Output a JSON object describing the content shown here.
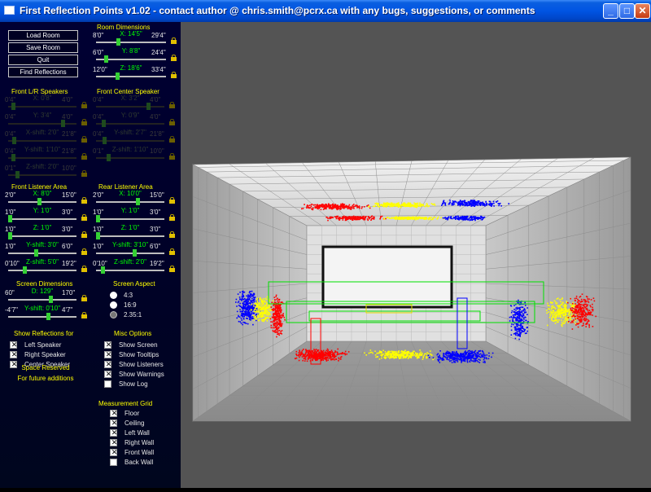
{
  "window": {
    "title": "First Reflection Points v1.02 - contact author @ chris.smith@pcrx.ca with any bugs, suggestions, or comments",
    "minimize": "_",
    "maximize": "□",
    "close": "✕"
  },
  "buttons": {
    "load": "Load Room",
    "save": "Save Room",
    "quit": "Quit",
    "find": "Find Reflections"
  },
  "room": {
    "header": "Room Dimensions",
    "sliders": [
      {
        "min": "8'0\"",
        "max": "29'4\"",
        "label": "X: 14'5\"",
        "value": 0.31,
        "enabled": true,
        "lock": true
      },
      {
        "min": "6'0\"",
        "max": "24'4\"",
        "label": "Y: 8'8\"",
        "value": 0.12,
        "enabled": true,
        "lock": true
      },
      {
        "min": "12'0\"",
        "max": "33'4\"",
        "label": "Z: 18'6\"",
        "value": 0.3,
        "enabled": true,
        "lock": true
      }
    ]
  },
  "front_lr": {
    "header": "Front L/R Speakers",
    "sliders": [
      {
        "min": "0'4\"",
        "max": "4'0\"",
        "label": "X: 0'8\"",
        "value": 0.05,
        "enabled": false,
        "lock": true
      },
      {
        "min": "0'4\"",
        "max": "4'0\"",
        "label": "Y: 3'4\"",
        "value": 0.82,
        "enabled": false,
        "lock": true
      },
      {
        "min": "0'4\"",
        "max": "21'8\"",
        "label": "X-shift: 2'0\"",
        "value": 0.06,
        "enabled": false,
        "lock": true
      },
      {
        "min": "0'4\"",
        "max": "21'8\"",
        "label": "Y-shift: 1'10\"",
        "value": 0.05,
        "enabled": false,
        "lock": true
      },
      {
        "min": "0'1\"",
        "max": "10'0\"",
        "label": "Z-shift: 2'0\"",
        "value": 0.12,
        "enabled": false,
        "lock": true
      }
    ]
  },
  "front_center": {
    "header": "Front Center Speaker",
    "sliders": [
      {
        "min": "0'4\"",
        "max": "4'0\"",
        "label": "X: 3'2\"",
        "value": 0.78,
        "enabled": false,
        "lock": true
      },
      {
        "min": "0'4\"",
        "max": "4'0\"",
        "label": "Y: 0'9\"",
        "value": 0.09,
        "enabled": false,
        "lock": true
      },
      {
        "min": "0'4\"",
        "max": "21'8\"",
        "label": "Y-shift: 2'7\"",
        "value": 0.1,
        "enabled": false,
        "lock": true
      },
      {
        "min": "0'1\"",
        "max": "10'0\"",
        "label": "Z-shift: 1'10\"",
        "value": 0.16,
        "enabled": false,
        "lock": true
      }
    ]
  },
  "front_listener": {
    "header": "Front Listener Area",
    "sliders": [
      {
        "min": "2'0\"",
        "max": "15'0\"",
        "label": "X: 8'0\"",
        "value": 0.46,
        "enabled": true,
        "lock": true
      },
      {
        "min": "1'0\"",
        "max": "3'0\"",
        "label": "Y: 1'0\"",
        "value": 0.0,
        "enabled": true,
        "lock": true
      },
      {
        "min": "1'0\"",
        "max": "3'0\"",
        "label": "Z: 1'0\"",
        "value": 0.0,
        "enabled": true,
        "lock": true
      },
      {
        "min": "1'0\"",
        "max": "6'0\"",
        "label": "Y-shift: 3'0\"",
        "value": 0.4,
        "enabled": true,
        "lock": true
      },
      {
        "min": "0'10\"",
        "max": "19'2\"",
        "label": "Z-shift: 5'0\"",
        "value": 0.23,
        "enabled": true,
        "lock": true
      }
    ]
  },
  "rear_listener": {
    "header": "Rear Listener Area",
    "sliders": [
      {
        "min": "2'0\"",
        "max": "15'0\"",
        "label": "X: 10'0\"",
        "value": 0.62,
        "enabled": true,
        "lock": true
      },
      {
        "min": "1'0\"",
        "max": "3'0\"",
        "label": "Y: 1'0\"",
        "value": 0.0,
        "enabled": true,
        "lock": true
      },
      {
        "min": "1'0\"",
        "max": "3'0\"",
        "label": "Z: 1'0\"",
        "value": 0.0,
        "enabled": true,
        "lock": true
      },
      {
        "min": "1'0\"",
        "max": "6'0\"",
        "label": "Y-shift: 3'10\"",
        "value": 0.57,
        "enabled": true,
        "lock": true
      },
      {
        "min": "0'10\"",
        "max": "19'2\"",
        "label": "Z-shift: 2'0\"",
        "value": 0.07,
        "enabled": true,
        "lock": true
      }
    ]
  },
  "screen": {
    "header": "Screen Dimensions",
    "sliders": [
      {
        "min": "60\"",
        "max": "170\"",
        "label": "D: 129\"",
        "value": 0.63,
        "enabled": true,
        "lock": true
      },
      {
        "min": "-4'7\"",
        "max": "4'7\"",
        "label": "Y-shift: 0'10\"",
        "value": 0.59,
        "enabled": true,
        "lock": true
      }
    ]
  },
  "aspect": {
    "header": "Screen Aspect",
    "options": [
      "4:3",
      "16:9",
      "2.35:1"
    ],
    "selected": "2.35:1"
  },
  "reflections": {
    "header": "Show Reflections for",
    "items": [
      {
        "label": "Left Speaker",
        "checked": true
      },
      {
        "label": "Right Speaker",
        "checked": true
      },
      {
        "label": "Center Speaker",
        "checked": true
      }
    ]
  },
  "misc": {
    "header": "Misc Options",
    "items": [
      {
        "label": "Show Screen",
        "checked": true
      },
      {
        "label": "Show Tooltips",
        "checked": true
      },
      {
        "label": "Show Listeners",
        "checked": true
      },
      {
        "label": "Show Warnings",
        "checked": true
      },
      {
        "label": "Show Log",
        "checked": false
      }
    ]
  },
  "grid": {
    "header": "Measurement Grid",
    "items": [
      {
        "label": "Floor",
        "checked": true
      },
      {
        "label": "Ceiling",
        "checked": true
      },
      {
        "label": "Left Wall",
        "checked": true
      },
      {
        "label": "Right Wall",
        "checked": true
      },
      {
        "label": "Front Wall",
        "checked": true
      },
      {
        "label": "Back Wall",
        "checked": false
      }
    ]
  },
  "reserved": {
    "line1": "Space Reserved",
    "line2": "For future additions"
  },
  "colors": {
    "left_speaker": "#ff0000",
    "right_speaker": "#0000ff",
    "center_speaker": "#ffff00",
    "listener_area": "#00ff00"
  }
}
